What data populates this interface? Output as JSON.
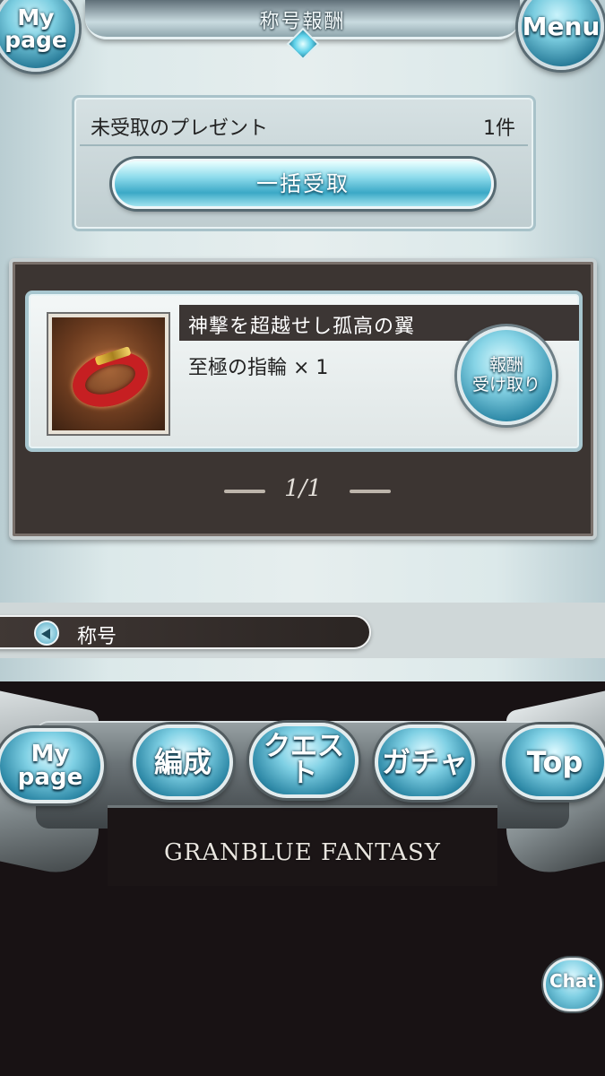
{
  "header": {
    "title": "称号報酬",
    "mypage_label": "My page",
    "menu_label": "Menu"
  },
  "present": {
    "label": "未受取のプレゼント",
    "count": "1件",
    "bulk_receive_label": "一括受取"
  },
  "reward": {
    "title": "神撃を超越せし孤高の翼",
    "item": "至極の指輪 × 1",
    "claim_label_line1": "報酬",
    "claim_label_line2": "受け取り",
    "item_icon": "ring-icon"
  },
  "pagination": {
    "page": "1/1"
  },
  "breadcrumb": {
    "label": "称号"
  },
  "bottom_nav": {
    "mypage": "My page",
    "party": "編成",
    "quest": "クエスト",
    "gacha": "ガチャ",
    "top": "Top"
  },
  "logo": "GRANBLUE FANTASY",
  "chat_label": "Chat",
  "colors": {
    "accent_blue": "#3ba8c6",
    "panel_dark": "#3c3532",
    "background_light": "#e6eeee"
  }
}
